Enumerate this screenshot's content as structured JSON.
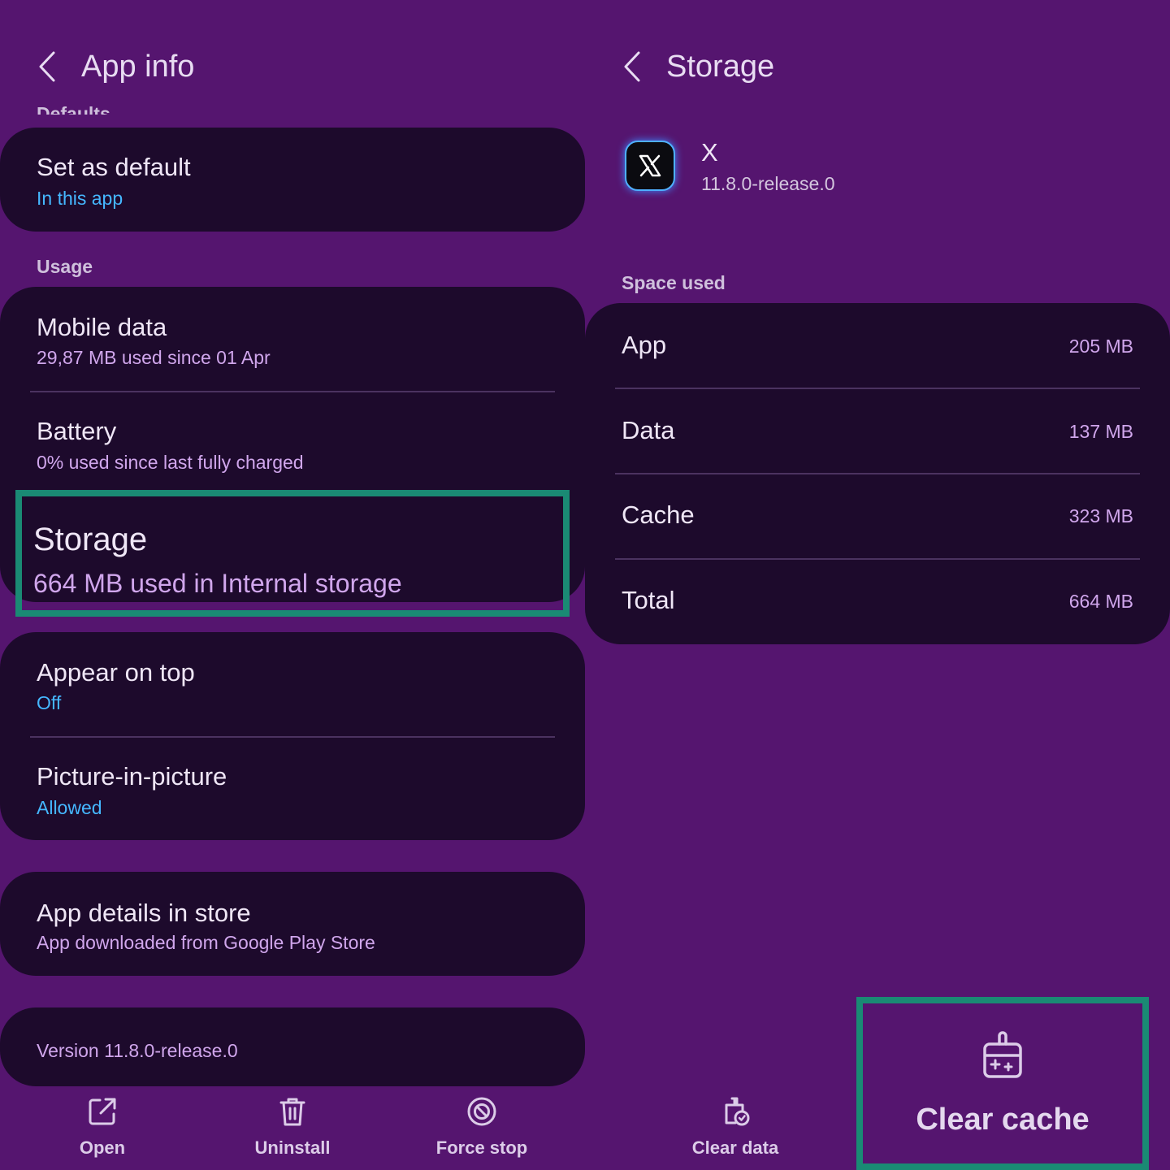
{
  "left": {
    "title": "App info",
    "partial_section": "Defaults",
    "set_default": {
      "title": "Set as default",
      "subtitle": "In this app"
    },
    "usage_label": "Usage",
    "mobile_data": {
      "title": "Mobile data",
      "subtitle": "29,87 MB used since 01 Apr"
    },
    "battery": {
      "title": "Battery",
      "subtitle": "0% used since last fully charged"
    },
    "storage": {
      "title": "Storage",
      "subtitle": "664 MB used in Internal storage"
    },
    "appear_on_top": {
      "title": "Appear on top",
      "subtitle": "Off"
    },
    "pip": {
      "title": "Picture-in-picture",
      "subtitle": "Allowed"
    },
    "store": {
      "title": "App details in store",
      "subtitle": "App downloaded from Google Play Store"
    },
    "version": "Version 11.8.0-release.0",
    "actions": {
      "open": "Open",
      "uninstall": "Uninstall",
      "force_stop": "Force stop"
    }
  },
  "right": {
    "title": "Storage",
    "app_name": "X",
    "app_version": "11.8.0-release.0",
    "space_used_label": "Space used",
    "rows": [
      {
        "label": "App",
        "value": "205 MB"
      },
      {
        "label": "Data",
        "value": "137 MB"
      },
      {
        "label": "Cache",
        "value": "323 MB"
      },
      {
        "label": "Total",
        "value": "664 MB"
      }
    ],
    "actions": {
      "clear_data": "Clear data",
      "clear_cache": "Clear cache"
    }
  },
  "colors": {
    "background": "#55156f",
    "card": "#1d0a2c",
    "accent_blue": "#45b7ff",
    "subtitle_pink": "#d0a6ec",
    "highlight_green": "#1a8a74"
  },
  "icons": [
    "back-arrow-icon",
    "x-logo-icon",
    "open-external-icon",
    "trash-icon",
    "block-icon",
    "clear-data-icon",
    "brush-icon"
  ]
}
